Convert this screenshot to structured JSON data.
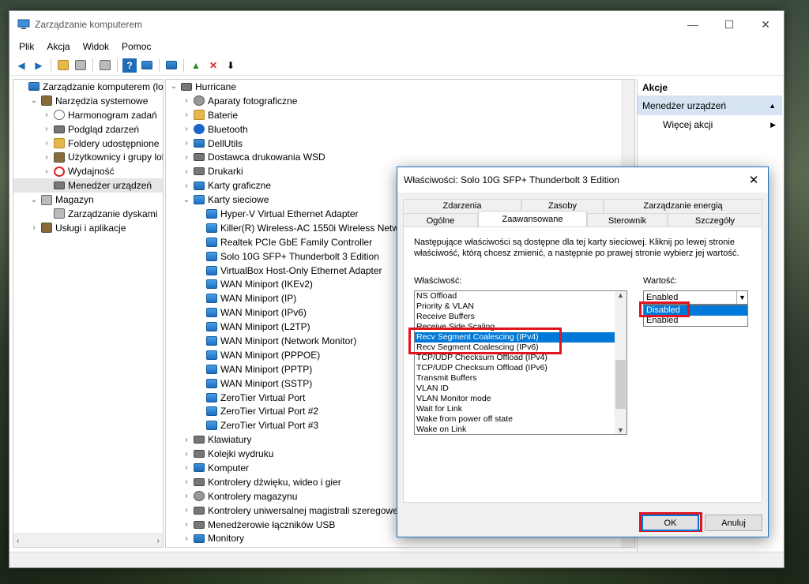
{
  "window": {
    "title": "Zarządzanie komputerem",
    "minimize": "—",
    "maximize": "☐",
    "close": "✕"
  },
  "menu": [
    "Plik",
    "Akcja",
    "Widok",
    "Pomoc"
  ],
  "left_tree": [
    {
      "indent": 0,
      "chev": "",
      "icon": "computer-icon",
      "cls": "mon",
      "label": "Zarządzanie komputerem (loka"
    },
    {
      "indent": 1,
      "chev": "⌄",
      "icon": "tools-icon",
      "cls": "tool",
      "label": "Narzędzia systemowe"
    },
    {
      "indent": 2,
      "chev": "›",
      "icon": "clock-icon",
      "cls": "clk",
      "label": "Harmonogram zadań"
    },
    {
      "indent": 2,
      "chev": "›",
      "icon": "event-viewer-icon",
      "cls": "dev",
      "label": "Podgląd zdarzeń"
    },
    {
      "indent": 2,
      "chev": "›",
      "icon": "shared-folder-icon",
      "cls": "fold",
      "label": "Foldery udostępnione"
    },
    {
      "indent": 2,
      "chev": "›",
      "icon": "users-icon",
      "cls": "tool",
      "label": "Użytkownicy i grupy lok"
    },
    {
      "indent": 2,
      "chev": "›",
      "icon": "performance-icon",
      "cls": "red",
      "label": "Wydajność"
    },
    {
      "indent": 2,
      "chev": "",
      "icon": "device-manager-icon",
      "cls": "dev",
      "label": "Menedżer urządzeń",
      "selected": true
    },
    {
      "indent": 1,
      "chev": "⌄",
      "icon": "storage-icon",
      "cls": "disk",
      "label": "Magazyn"
    },
    {
      "indent": 2,
      "chev": "",
      "icon": "disk-management-icon",
      "cls": "disk",
      "label": "Zarządzanie dyskami"
    },
    {
      "indent": 1,
      "chev": "›",
      "icon": "services-icon",
      "cls": "tool",
      "label": "Usługi i aplikacje"
    }
  ],
  "device_tree": [
    {
      "indent": 0,
      "chev": "⌄",
      "icon": "computer-icon",
      "cls": "dev",
      "label": "Hurricane"
    },
    {
      "indent": 1,
      "chev": "›",
      "icon": "camera-icon",
      "cls": "gear",
      "label": "Aparaty fotograficzne"
    },
    {
      "indent": 1,
      "chev": "›",
      "icon": "battery-icon",
      "cls": "fold",
      "label": "Baterie"
    },
    {
      "indent": 1,
      "chev": "›",
      "icon": "bluetooth-icon",
      "cls": "bt",
      "label": "Bluetooth"
    },
    {
      "indent": 1,
      "chev": "›",
      "icon": "monitor-icon",
      "cls": "mon",
      "label": "DellUtils"
    },
    {
      "indent": 1,
      "chev": "›",
      "icon": "printer-icon",
      "cls": "dev",
      "label": "Dostawca drukowania WSD"
    },
    {
      "indent": 1,
      "chev": "›",
      "icon": "printer-icon",
      "cls": "dev",
      "label": "Drukarki"
    },
    {
      "indent": 1,
      "chev": "›",
      "icon": "display-adapter-icon",
      "cls": "mon",
      "label": "Karty graficzne"
    },
    {
      "indent": 1,
      "chev": "⌄",
      "icon": "network-adapter-icon",
      "cls": "net",
      "label": "Karty sieciowe"
    },
    {
      "indent": 2,
      "chev": "",
      "icon": "network-adapter-icon",
      "cls": "net",
      "label": "Hyper-V Virtual Ethernet Adapter"
    },
    {
      "indent": 2,
      "chev": "",
      "icon": "network-adapter-icon",
      "cls": "net",
      "label": "Killer(R) Wireless-AC 1550i Wireless Netw"
    },
    {
      "indent": 2,
      "chev": "",
      "icon": "network-adapter-icon",
      "cls": "net",
      "label": "Realtek PCIe GbE Family Controller"
    },
    {
      "indent": 2,
      "chev": "",
      "icon": "network-adapter-icon",
      "cls": "net",
      "label": "Solo 10G SFP+ Thunderbolt 3 Edition"
    },
    {
      "indent": 2,
      "chev": "",
      "icon": "network-adapter-icon",
      "cls": "net",
      "label": "VirtualBox Host-Only Ethernet Adapter"
    },
    {
      "indent": 2,
      "chev": "",
      "icon": "network-adapter-icon",
      "cls": "net",
      "label": "WAN Miniport (IKEv2)"
    },
    {
      "indent": 2,
      "chev": "",
      "icon": "network-adapter-icon",
      "cls": "net",
      "label": "WAN Miniport (IP)"
    },
    {
      "indent": 2,
      "chev": "",
      "icon": "network-adapter-icon",
      "cls": "net",
      "label": "WAN Miniport (IPv6)"
    },
    {
      "indent": 2,
      "chev": "",
      "icon": "network-adapter-icon",
      "cls": "net",
      "label": "WAN Miniport (L2TP)"
    },
    {
      "indent": 2,
      "chev": "",
      "icon": "network-adapter-icon",
      "cls": "net",
      "label": "WAN Miniport (Network Monitor)"
    },
    {
      "indent": 2,
      "chev": "",
      "icon": "network-adapter-icon",
      "cls": "net",
      "label": "WAN Miniport (PPPOE)"
    },
    {
      "indent": 2,
      "chev": "",
      "icon": "network-adapter-icon",
      "cls": "net",
      "label": "WAN Miniport (PPTP)"
    },
    {
      "indent": 2,
      "chev": "",
      "icon": "network-adapter-icon",
      "cls": "net",
      "label": "WAN Miniport (SSTP)"
    },
    {
      "indent": 2,
      "chev": "",
      "icon": "network-adapter-icon",
      "cls": "net",
      "label": "ZeroTier Virtual Port"
    },
    {
      "indent": 2,
      "chev": "",
      "icon": "network-adapter-icon",
      "cls": "net",
      "label": "ZeroTier Virtual Port #2"
    },
    {
      "indent": 2,
      "chev": "",
      "icon": "network-adapter-icon",
      "cls": "net",
      "label": "ZeroTier Virtual Port #3"
    },
    {
      "indent": 1,
      "chev": "›",
      "icon": "keyboard-icon",
      "cls": "dev",
      "label": "Klawiatury"
    },
    {
      "indent": 1,
      "chev": "›",
      "icon": "print-queue-icon",
      "cls": "dev",
      "label": "Kolejki wydruku"
    },
    {
      "indent": 1,
      "chev": "›",
      "icon": "computer-icon",
      "cls": "mon",
      "label": "Komputer"
    },
    {
      "indent": 1,
      "chev": "›",
      "icon": "sound-icon",
      "cls": "dev",
      "label": "Kontrolery dźwięku, wideo i gier"
    },
    {
      "indent": 1,
      "chev": "›",
      "icon": "storage-controller-icon",
      "cls": "gear",
      "label": "Kontrolery magazynu"
    },
    {
      "indent": 1,
      "chev": "›",
      "icon": "usb-icon",
      "cls": "dev",
      "label": "Kontrolery uniwersalnej magistrali szeregowe"
    },
    {
      "indent": 1,
      "chev": "›",
      "icon": "usb-icon",
      "cls": "dev",
      "label": "Menedżerowie łączników USB"
    },
    {
      "indent": 1,
      "chev": "›",
      "icon": "monitor-icon",
      "cls": "mon",
      "label": "Monitory"
    }
  ],
  "actions": {
    "header": "Akcje",
    "section": "Menedżer urządzeń",
    "more": "Więcej akcji"
  },
  "dialog": {
    "title": "Właściwości: Solo 10G SFP+ Thunderbolt 3 Edition",
    "close": "✕",
    "tabs_back": [
      "Zdarzenia",
      "Zasoby",
      "Zarządzanie energią"
    ],
    "tabs_front": [
      "Ogólne",
      "Zaawansowane",
      "Sterownik",
      "Szczegóły"
    ],
    "active_tab": "Zaawansowane",
    "description": "Następujące właściwości są dostępne dla tej karty sieciowej. Kliknij po lewej stronie właściwość, którą chcesz zmienić, a następnie po prawej stronie wybierz jej wartość.",
    "property_label": "Właściwość:",
    "value_label": "Wartość:",
    "properties": [
      "NS Offload",
      "Priority & VLAN",
      "Receive Buffers",
      "Receive Side Scaling",
      "Recv Segment Coalescing (IPv4)",
      "Recv Segment Coalescing (IPv6)",
      "TCP/UDP Checksum Offload (IPv4)",
      "TCP/UDP Checksum Offload (IPv6)",
      "Transmit Buffers",
      "VLAN ID",
      "VLAN Monitor mode",
      "Wait for Link",
      "Wake from power off state",
      "Wake on Link"
    ],
    "selected_property": "Recv Segment Coalescing (IPv4)",
    "value_selected": "Enabled",
    "value_options": [
      "Disabled",
      "Enabled"
    ],
    "value_highlighted": "Disabled",
    "ok": "OK",
    "cancel": "Anuluj"
  }
}
